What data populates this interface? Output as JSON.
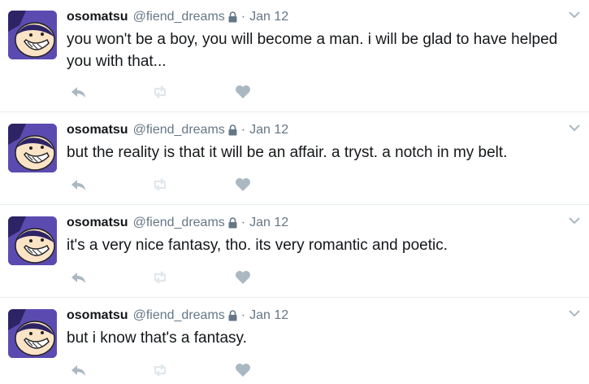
{
  "colors": {
    "name": "#14171a",
    "meta": "#657786",
    "icons": "#aab8c2",
    "divider": "#e6ecf0",
    "avatar_bg": "#5b4bb0"
  },
  "icons": {
    "reply": "reply-icon",
    "retweet": "retweet-icon",
    "like": "heart-icon",
    "lock": "lock-icon",
    "more": "chevron-down-icon",
    "avatar": "avatar"
  },
  "tweets": [
    {
      "name": "osomatsu",
      "handle": "@fiend_dreams",
      "separator": "·",
      "date": "Jan 12",
      "text": "you won't be a boy, you will become a man. i will be glad to have helped you with that..."
    },
    {
      "name": "osomatsu",
      "handle": "@fiend_dreams",
      "separator": "·",
      "date": "Jan 12",
      "text": "but the reality is that it will be an affair. a tryst. a notch in my belt."
    },
    {
      "name": "osomatsu",
      "handle": "@fiend_dreams",
      "separator": "·",
      "date": "Jan 12",
      "text": "it's a very nice fantasy, tho. its very romantic and poetic."
    },
    {
      "name": "osomatsu",
      "handle": "@fiend_dreams",
      "separator": "·",
      "date": "Jan 12",
      "text": "but i know that's a fantasy."
    }
  ]
}
